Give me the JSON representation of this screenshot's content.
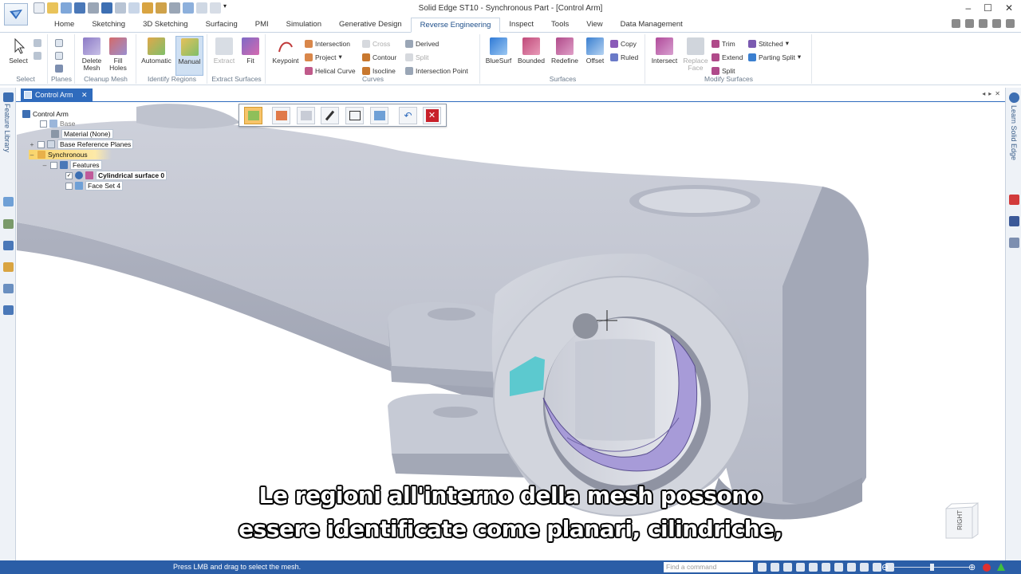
{
  "window": {
    "title": "Solid Edge ST10 - Synchronous Part - [Control Arm]"
  },
  "tabs": [
    "Home",
    "Sketching",
    "3D Sketching",
    "Surfacing",
    "PMI",
    "Simulation",
    "Generative Design",
    "Reverse Engineering",
    "Inspect",
    "Tools",
    "View",
    "Data Management"
  ],
  "active_tab": "Reverse Engineering",
  "ribbon": {
    "select": {
      "label": "Select",
      "group": "Select"
    },
    "planes": {
      "label": "Planes"
    },
    "cleanup": {
      "delete_mesh": "Delete\nMesh",
      "fill_holes": "Fill\nHoles",
      "group": "Cleanup Mesh"
    },
    "identify": {
      "automatic": "Automatic",
      "manual": "Manual",
      "group": "Identify Regions"
    },
    "extract": {
      "extract": "Extract",
      "fit": "Fit",
      "group": "Extract Surfaces"
    },
    "curves": {
      "keypoint": "Keypoint",
      "intersection": "Intersection",
      "cross": "Cross",
      "derived": "Derived",
      "project": "Project",
      "contour": "Contour",
      "split": "Split",
      "helical": "Helical Curve",
      "isocline": "Isocline",
      "intersection_point": "Intersection Point",
      "group": "Curves"
    },
    "surfaces": {
      "bluesurf": "BlueSurf",
      "bounded": "Bounded",
      "redefine": "Redefine",
      "offset": "Offset",
      "copy": "Copy",
      "ruled": "Ruled",
      "group": "Surfaces"
    },
    "modify": {
      "intersect": "Intersect",
      "replace_face": "Replace\nFace",
      "trim": "Trim",
      "extend": "Extend",
      "split": "Split",
      "stitched": "Stitched",
      "parting_split": "Parting Split",
      "group": "Modify Surfaces"
    }
  },
  "document": {
    "tab_label": "Control Arm",
    "close": "✕"
  },
  "side_panels": {
    "left": "Feature Library",
    "right": "Learn Solid Edge"
  },
  "tree": {
    "root": "Control Arm",
    "base": "Base",
    "material": "Material (None)",
    "ref_planes": "Base Reference Planes",
    "synchronous": "Synchronous",
    "features": "Features",
    "cyl_surface": "Cylindrical surface 0",
    "face_set": "Face Set 4"
  },
  "view_cube": {
    "face": "RIGHT"
  },
  "subtitle": {
    "line1": "Le regioni all'interno della mesh possono",
    "line2": "essere identificate come planari, cilindriche,"
  },
  "status": {
    "message": "Press LMB and drag to select the mesh.",
    "find_placeholder": "Find a command"
  },
  "colors": {
    "accent": "#2b5ea7",
    "model": "#c4c8d3",
    "region_cyan": "#5cc9cf",
    "region_purple": "#a79bd8"
  }
}
